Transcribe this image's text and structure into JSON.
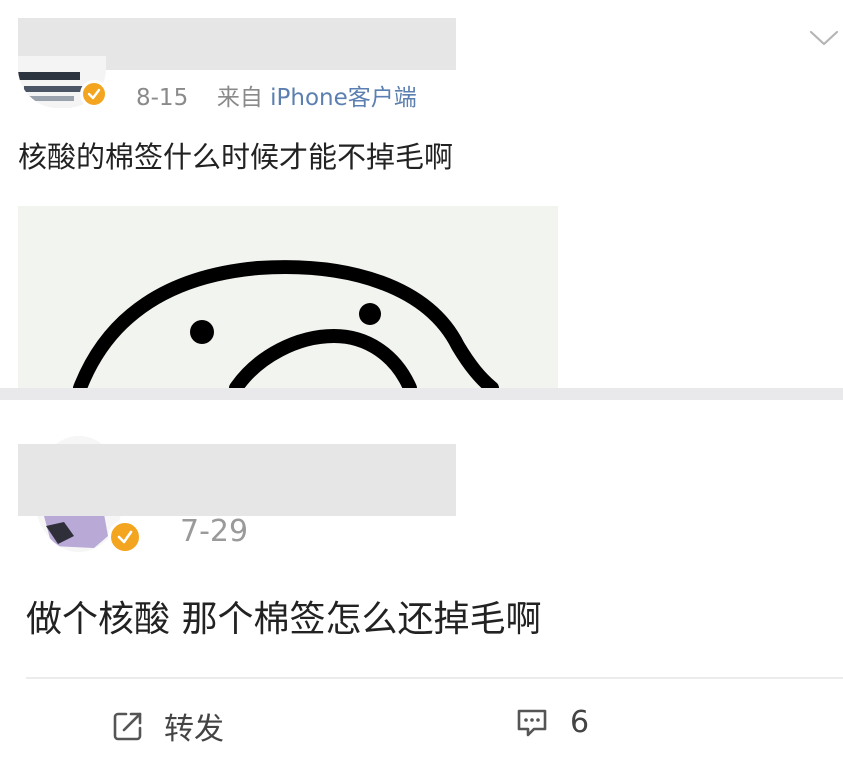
{
  "post1": {
    "time": "8-15",
    "source_prefix": "来自",
    "source": "iPhone客户端",
    "text": "核酸的棉签什么时候才能不掉毛啊"
  },
  "post2": {
    "time": "7-29",
    "text": "做个核酸 那个棉签怎么还掉毛啊",
    "actions": {
      "repost_label": "转发",
      "comment_count": "6"
    }
  },
  "icons": {
    "dropdown": "chevron-down-icon",
    "verified": "verified-badge-icon",
    "repost": "repost-icon",
    "comment": "comment-icon"
  },
  "colors": {
    "verified": "#f3a51f",
    "source_link": "#5b7fb0",
    "meta": "#8a8a8a"
  }
}
